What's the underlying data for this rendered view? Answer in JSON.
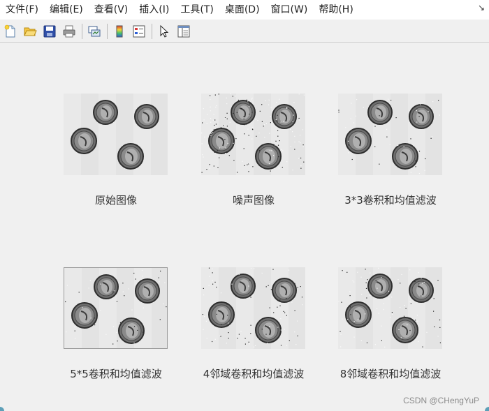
{
  "menubar": {
    "items": [
      "文件(F)",
      "编辑(E)",
      "查看(V)",
      "插入(I)",
      "工具(T)",
      "桌面(D)",
      "窗口(W)",
      "帮助(H)"
    ],
    "dock_glyph": "↘"
  },
  "toolbar": {
    "buttons": [
      "new-figure-icon",
      "open-folder-icon",
      "save-icon",
      "print-icon",
      "link-plot-icon",
      "colorbar-icon",
      "legend-icon",
      "pointer-icon",
      "property-editor-icon"
    ]
  },
  "panels": [
    {
      "caption": "原始图像",
      "noise": "none"
    },
    {
      "caption": "噪声图像",
      "noise": "heavy"
    },
    {
      "caption": "3*3卷积和均值滤波",
      "noise": "light"
    },
    {
      "caption": "5*5卷积和均值滤波",
      "noise": "light"
    },
    {
      "caption": "4邻域卷积和均值滤波",
      "noise": "medium"
    },
    {
      "caption": "8邻域卷积和均值滤波",
      "noise": "medium"
    }
  ],
  "watermark": "CSDN @CHengYuP",
  "colors": {
    "menubar_bg": "#ffffff",
    "window_bg": "#f0f0f0",
    "image_bg": "#e6e6e6"
  }
}
